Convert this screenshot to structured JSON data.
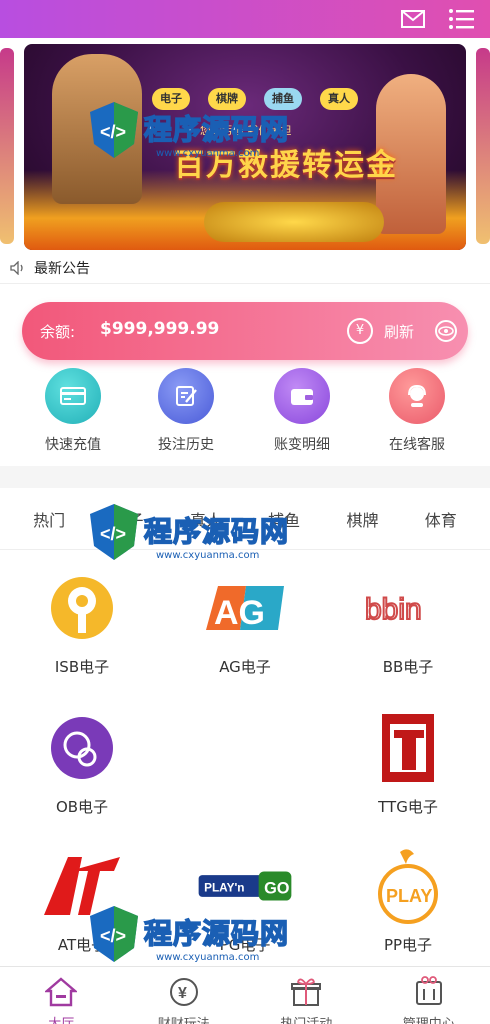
{
  "banner": {
    "chips": [
      "电子",
      "棋牌",
      "捕鱼",
      "真人"
    ],
    "subtitle": "您的亏损 我们承担",
    "title": "百万救援转运金"
  },
  "notice": {
    "label": "最新公告"
  },
  "balance": {
    "label": "余额:",
    "value": "$999,999.99",
    "refresh_label": "刷新"
  },
  "quick_actions": [
    {
      "label": "快速充值",
      "icon": "card-icon",
      "color": "#2fc5c8"
    },
    {
      "label": "投注历史",
      "icon": "edit-icon",
      "color": "#5a6fe0"
    },
    {
      "label": "账变明细",
      "icon": "wallet-icon",
      "color": "#9c5be8"
    },
    {
      "label": "在线客服",
      "icon": "support-icon",
      "color": "#f06a6a"
    }
  ],
  "tabs": [
    "热门",
    "电子",
    "真人",
    "捕鱼",
    "棋牌",
    "体育"
  ],
  "games": [
    {
      "label": "ISB电子",
      "logo": "isb-logo"
    },
    {
      "label": "AG电子",
      "logo": "ag-logo"
    },
    {
      "label": "BB电子",
      "logo": "bbin-logo"
    },
    {
      "label": "OB电子",
      "logo": "ob-logo"
    },
    {
      "label": "TTG电子",
      "logo": "ttg-logo"
    },
    {
      "label": "AT电子",
      "logo": "at-logo"
    },
    {
      "label": "PG电子",
      "logo": "playngo-logo"
    },
    {
      "label": "PP电子",
      "logo": "pp-logo"
    }
  ],
  "watermark": {
    "text": "程序源码网",
    "url": "www.cxyuanma.com"
  },
  "bottom_nav": [
    {
      "label": "大厅",
      "icon": "home-icon",
      "active": true
    },
    {
      "label": "财财玩法",
      "icon": "yen-coin-icon",
      "active": false
    },
    {
      "label": "热门活动",
      "icon": "gift-icon",
      "active": false
    },
    {
      "label": "管理中心",
      "icon": "profile-box-icon",
      "active": false
    }
  ],
  "colors": {
    "accent": "#d04fc0",
    "balance_start": "#f2587a",
    "balance_end": "#f78fb0"
  }
}
